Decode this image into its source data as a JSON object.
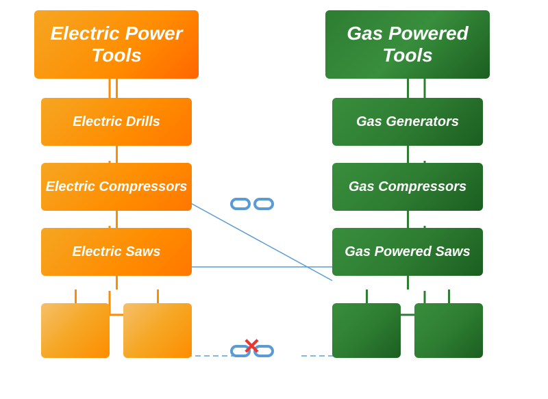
{
  "left": {
    "root": "Electric Power Tools",
    "children": [
      "Electric Drills",
      "Electric Compressors",
      "Electric Saws"
    ]
  },
  "right": {
    "root": "Gas Powered Tools",
    "children": [
      "Gas Generators",
      "Gas Compressors",
      "Gas Powered Saws"
    ]
  },
  "chain_middle": "⛓",
  "chain_broken": "⛓",
  "x_mark": "✕",
  "colors": {
    "orange_root": "#ff8c00",
    "orange_child": "#ff8c00",
    "green_root": "#2e7d32",
    "green_child": "#2e7d32",
    "line_orange": "#ff8c00",
    "line_green": "#2e7d32",
    "chain_color": "#5b9bd5",
    "x_color": "#e53935",
    "dashed_line": "#5b9bd5"
  }
}
